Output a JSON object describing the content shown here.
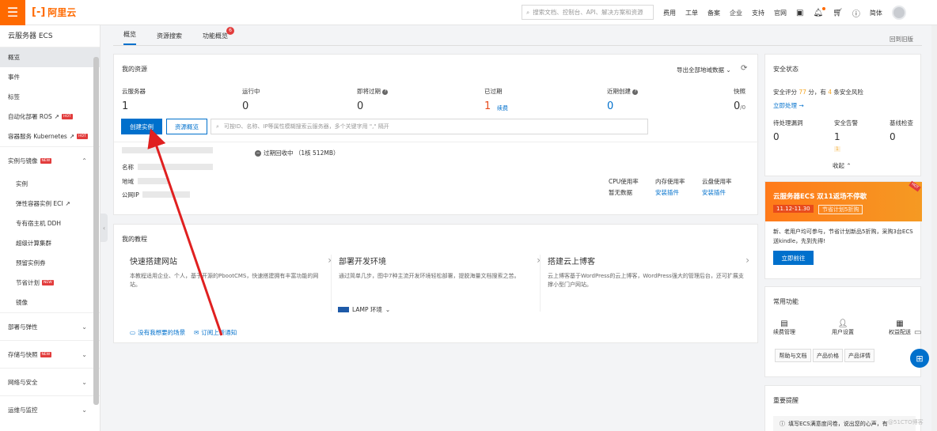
{
  "header": {
    "logo_text": "阿里云",
    "search_placeholder": "搜索文档、控制台、API、解决方案和资源",
    "nav": [
      "费用",
      "工单",
      "备案",
      "企业",
      "支持",
      "官网"
    ],
    "lang": "简体"
  },
  "sidebar": {
    "title": "云服务器 ECS",
    "items": [
      {
        "label": "概览",
        "active": true
      },
      {
        "label": "事件"
      },
      {
        "label": "标签"
      },
      {
        "label": "自动化部署 ROS",
        "hot": "HOT"
      },
      {
        "label": "容器服务 Kubernetes",
        "hot": "HOT"
      }
    ],
    "group_instances": {
      "label": "实例与镜像",
      "tag": "NEW"
    },
    "sub_items": [
      {
        "label": "实例"
      },
      {
        "label": "弹性容器实例 ECI"
      },
      {
        "label": "专有宿主机 DDH"
      },
      {
        "label": "超级计算集群"
      },
      {
        "label": "预留实例券"
      },
      {
        "label": "节省计划",
        "tag": "NEW"
      },
      {
        "label": "镜像"
      }
    ],
    "groups": [
      {
        "label": "部署与弹性"
      },
      {
        "label": "存储与快照",
        "tag": "NEW"
      },
      {
        "label": "网络与安全"
      },
      {
        "label": "运维与监控"
      }
    ]
  },
  "tabs": {
    "items": [
      {
        "label": "概览",
        "active": true
      },
      {
        "label": "资源搜索"
      },
      {
        "label": "功能概览",
        "badge": "6"
      }
    ],
    "back_link": "回到旧版"
  },
  "resources": {
    "title": "我的资源",
    "export": "导出全部地域数据",
    "stats": [
      {
        "label": "云服务器",
        "value": "1"
      },
      {
        "label": "运行中",
        "value": "0"
      },
      {
        "label": "即将过期",
        "value": "0"
      },
      {
        "label": "已过期",
        "value": "1",
        "link": "续费"
      },
      {
        "label": "近期创建",
        "value": "0"
      },
      {
        "label": "快照",
        "value": "0",
        "suffix": "/0"
      }
    ],
    "create_btn": "创建实例",
    "overview_btn": "资源概览",
    "search_placeholder": "可按ID、名称、IP等属性模糊搜索云服务器，多个关键字用 \",\" 隔开",
    "instance": {
      "status": "过期回收中 （1核 512MB）",
      "name_label": "名称",
      "region_label": "地域",
      "ip_label": "公网IP",
      "cpu_label": "CPU使用率",
      "mem_label": "内存使用率",
      "disk_label": "云盘使用率",
      "cpu_value": "暂无数据",
      "mem_value": "安装插件",
      "disk_value": "安装插件"
    }
  },
  "tutorials": {
    "title": "我的教程",
    "items": [
      {
        "title": "快速搭建网站",
        "desc": "本教程适用企业、个人，基于开源的PbootCMS，快速搭建拥有丰富功能的网站。"
      },
      {
        "title": "部署开发环境",
        "desc": "通过简单几步，图中7种主流开发环境轻松部署，提脱海量文档搜索之苦。",
        "lamp": "LAMP 环境"
      },
      {
        "title": "搭建云上博客",
        "desc": "云上博客基于WordPress的云上博客，WordPress强大的管理后台，还可扩展支撑小型门户网站。"
      }
    ],
    "links": [
      "没有我想要的场景",
      "订阅上新通知"
    ]
  },
  "security": {
    "title": "安全状态",
    "score_text_pre": "安全评分",
    "score": "77",
    "score_text_mid": "分，有",
    "risk_count": "4",
    "score_text_post": "条安全风险",
    "action": "立即处理",
    "cols": [
      {
        "label": "待处理漏洞",
        "value": "0"
      },
      {
        "label": "安全告警",
        "value": "1",
        "sub": "1"
      },
      {
        "label": "基线检查",
        "value": "0"
      }
    ],
    "collapse": "收起"
  },
  "promo": {
    "title": "云服务器ECS 双11返场不停歇",
    "date": "11.12-11.30",
    "tag": "节省计划5折购",
    "corner": "HOT",
    "text": "新、老用户均可参与，节省计划新品5折购，采购3台ECS送kindle，先到先得!",
    "btn": "立即前往"
  },
  "functions": {
    "title": "常用功能",
    "items": [
      {
        "label": "续费管理"
      },
      {
        "label": "用户设置"
      },
      {
        "label": "权益配送"
      }
    ],
    "buttons": [
      "帮助与文档",
      "产品价格",
      "产品详情"
    ]
  },
  "notice": {
    "title": "重要提醒",
    "text": "填写ECS满意度问卷，说出您的心声，有"
  },
  "watermark": "@51CTO博客",
  "colors": {
    "brand": "#ff6a00",
    "primary": "#0070cc",
    "danger": "#e23c3c"
  }
}
